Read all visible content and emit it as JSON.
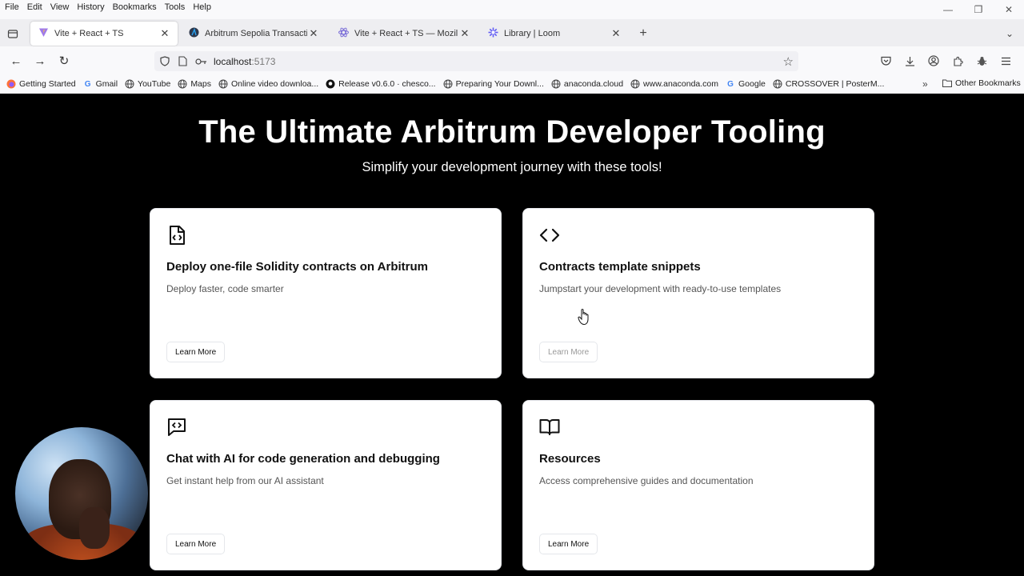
{
  "menu": [
    "File",
    "Edit",
    "View",
    "History",
    "Bookmarks",
    "Tools",
    "Help"
  ],
  "tabs": [
    {
      "title": "Vite + React + TS",
      "icon": "vite-icon",
      "active": true
    },
    {
      "title": "Arbitrum Sepolia Transaction H",
      "icon": "arbitrum-icon",
      "active": false
    },
    {
      "title": "Vite + React + TS — Mozilla Fir",
      "icon": "react-icon",
      "active": false
    },
    {
      "title": "Library | Loom",
      "icon": "loom-icon",
      "active": false
    }
  ],
  "url": {
    "host": "localhost",
    "port": ":5173"
  },
  "bookmarks": [
    {
      "label": "Getting Started",
      "icon": "firefox-icon"
    },
    {
      "label": "Gmail",
      "icon": "google-icon"
    },
    {
      "label": "YouTube",
      "icon": "globe-icon"
    },
    {
      "label": "Maps",
      "icon": "globe-icon"
    },
    {
      "label": "Online video downloa...",
      "icon": "globe-icon"
    },
    {
      "label": "Release v0.6.0 · chesco...",
      "icon": "github-icon"
    },
    {
      "label": "Preparing Your Downl...",
      "icon": "globe-icon"
    },
    {
      "label": "anaconda.cloud",
      "icon": "globe-icon"
    },
    {
      "label": "www.anaconda.com",
      "icon": "globe-icon"
    },
    {
      "label": "Google",
      "icon": "google-icon"
    },
    {
      "label": "CROSSOVER | PosterM...",
      "icon": "globe-icon"
    }
  ],
  "other_bookmarks": "Other Bookmarks",
  "hero": {
    "title": "The Ultimate Arbitrum Developer Tooling",
    "subtitle": "Simplify your development journey with these tools!"
  },
  "cards": [
    {
      "title": "Deploy one-file Solidity contracts on Arbitrum",
      "desc": "Deploy faster, code smarter",
      "button": "Learn More",
      "icon": "file-code-icon"
    },
    {
      "title": "Contracts template snippets",
      "desc": "Jumpstart your development with ready-to-use templates",
      "button": "Learn More",
      "icon": "code-icon"
    },
    {
      "title": "Chat with AI for code generation and debugging",
      "desc": "Get instant help from our AI assistant",
      "button": "Learn More",
      "icon": "message-code-icon"
    },
    {
      "title": "Resources",
      "desc": "Access comprehensive guides and documentation",
      "button": "Learn More",
      "icon": "book-open-icon"
    }
  ]
}
